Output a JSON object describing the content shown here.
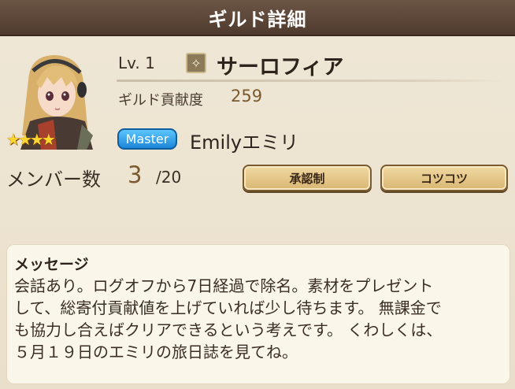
{
  "header": {
    "title": "ギルド詳細"
  },
  "guild": {
    "level": "Lv.  1",
    "rank_icon": "guild-rank-icon",
    "name": "サーロフィア",
    "contribution_label": "ギルド貢献度",
    "contribution_value": "259",
    "master_badge": "Master",
    "master_name": "Emilyエミリ",
    "stars": 4,
    "members_label": "メンバー数",
    "members_count": "3",
    "members_max": "/20"
  },
  "buttons": {
    "approval": "承認制",
    "style": "コツコツ"
  },
  "message": {
    "title": "メッセージ",
    "body": "会話あり。ログオフから7日経過で除名。素材をプレゼント\nして、総寄付貢献値を上げていれば少し待ちます。 無課金で\nも協力し合えばクリアできるという考えです。 くわしくは、\n５月１９日のエミリの旅日誌を見てね。"
  },
  "colors": {
    "header_bg": "#5a4537",
    "accent_value": "#7a5a2e",
    "master_badge": "#1c86d8",
    "button_bg": "#e3c488"
  }
}
